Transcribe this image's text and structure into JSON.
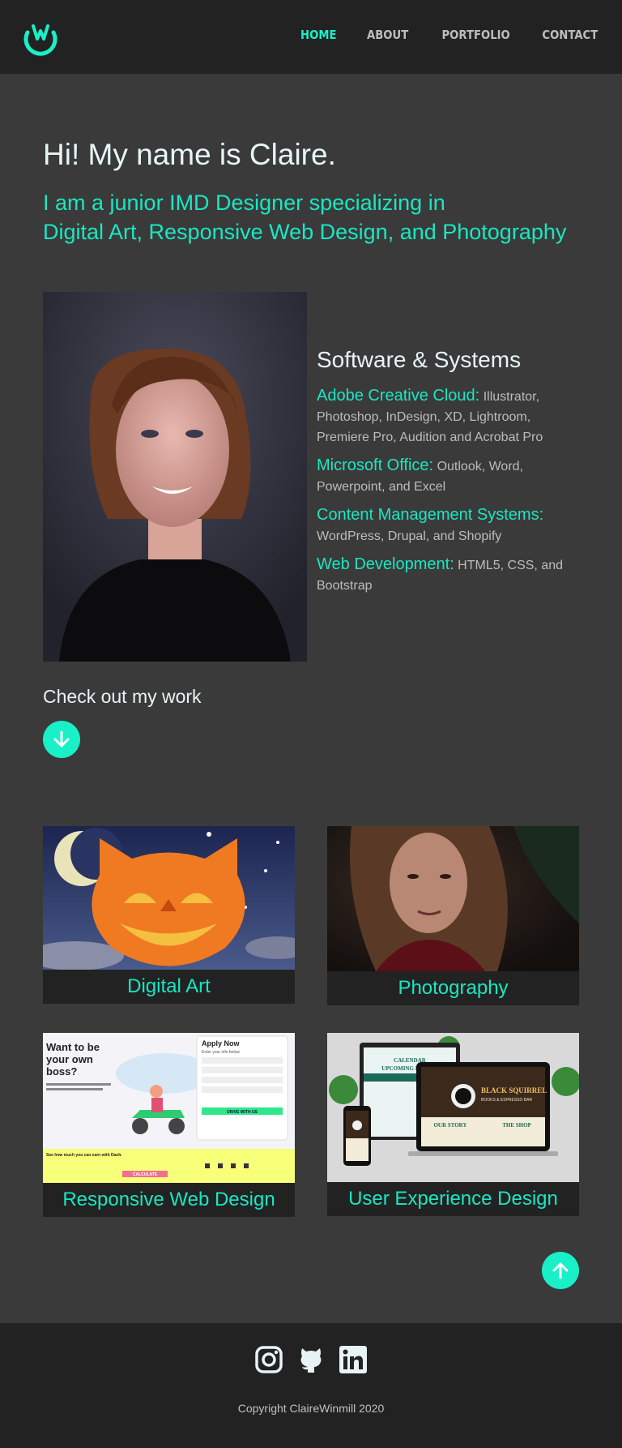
{
  "nav": {
    "items": [
      {
        "label": "HOME",
        "active": true
      },
      {
        "label": "ABOUT",
        "active": false
      },
      {
        "label": "PORTFOLIO",
        "active": false
      },
      {
        "label": "CONTACT",
        "active": false
      }
    ],
    "logo_icon": "w-logo-icon"
  },
  "colors": {
    "accent": "#19f0c8",
    "background": "#3a3a3a",
    "dark": "#222222"
  },
  "hero": {
    "title": "Hi! My name is Claire.",
    "subtitle_line1": "I am a junior IMD Designer specializing in",
    "subtitle_line2": "Digital Art, Responsive Web Design, and Photography"
  },
  "skills": {
    "title": "Software & Systems",
    "items": [
      {
        "name": "Adobe Creative Cloud:",
        "detail": "Illustrator, Photoshop, InDesign, XD, Lightroom, Premiere Pro, Audition and Acrobat Pro"
      },
      {
        "name": "Microsoft Office:",
        "detail": "Outlook, Word, Powerpoint, and Excel"
      },
      {
        "name": "Content Management Systems:",
        "detail": "WordPress, Drupal, and Shopify"
      },
      {
        "name": "Web Development:",
        "detail": "HTML5, CSS, and Bootstrap"
      }
    ]
  },
  "work": {
    "title": "Check out my work",
    "down_icon": "arrow-down-icon",
    "up_icon": "arrow-up-icon"
  },
  "cards": [
    {
      "label": "Digital Art"
    },
    {
      "label": "Photography"
    },
    {
      "label": "Responsive Web Design"
    },
    {
      "label": "User Experience Design"
    }
  ],
  "rwd_mock": {
    "headline1": "Want to be",
    "headline2": "your own",
    "headline3": "boss?",
    "form_title": "Apply Now",
    "form_sub": "Enter your info below",
    "button": "DRIVE WITH US",
    "calc": "CALCULATE",
    "earn": "See how much you can earn with Dash."
  },
  "ux_mock": {
    "brand": "BLACK SQUIRREL",
    "brand_sub": "BOOKS & ESPRESSO BAR",
    "story": "OUR STORY",
    "shop": "THE SHOP",
    "calendar": "CALENDAR",
    "events": "UPCOMING EVENTS"
  },
  "footer": {
    "socials": [
      "instagram-icon",
      "github-icon",
      "linkedin-icon"
    ],
    "copyright": "Copyright ClaireWinmill 2020"
  }
}
